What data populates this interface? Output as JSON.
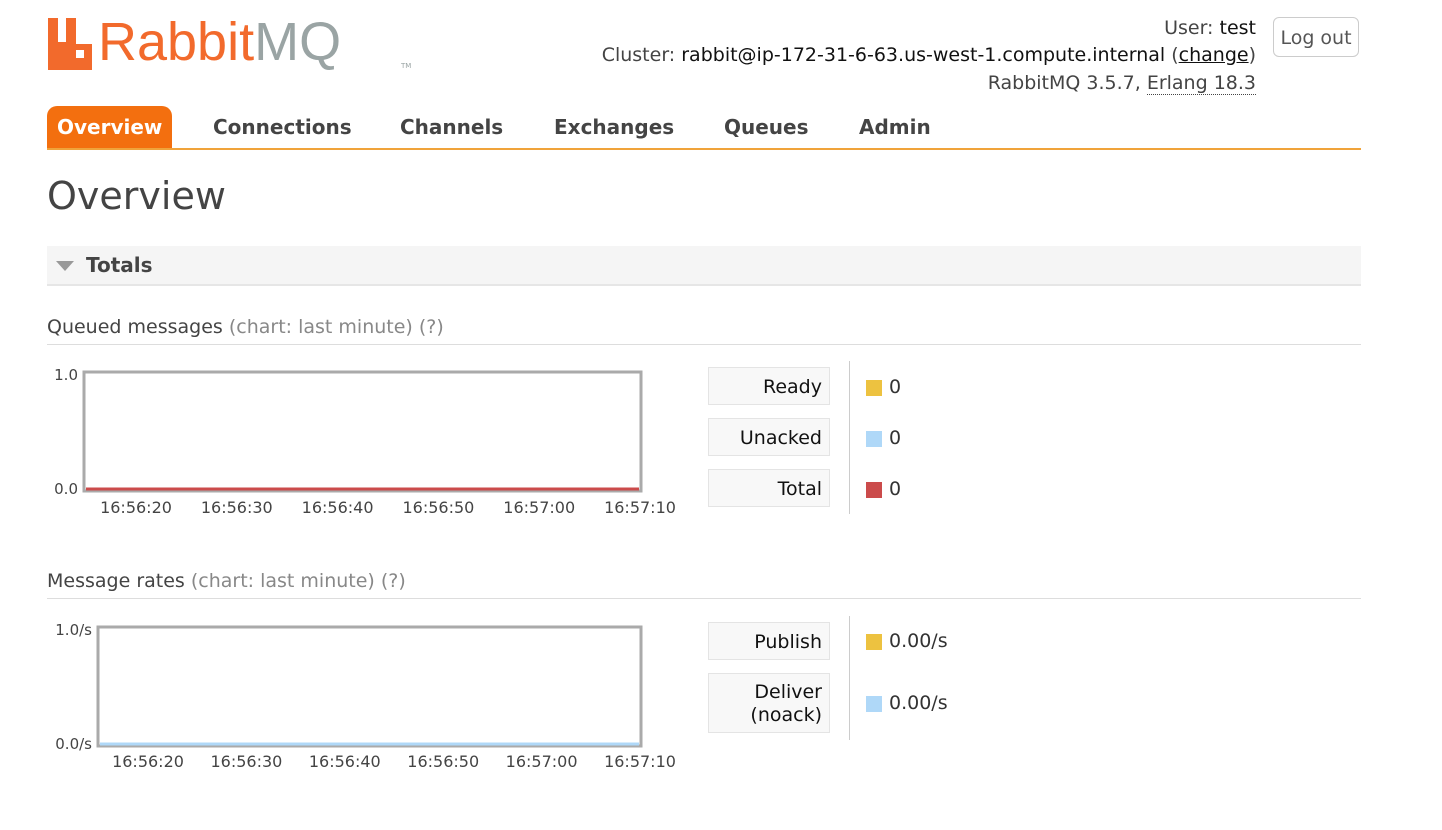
{
  "brand": {
    "rabbit": "Rabbit",
    "mq": "MQ",
    "tm": "TM"
  },
  "header": {
    "user_label": "User:",
    "user_value": "test",
    "cluster_label": "Cluster:",
    "cluster_value": "rabbit@ip-172-31-6-63.us-west-1.compute.internal",
    "change_link": "change",
    "version_text": "RabbitMQ 3.5.7,",
    "erlang_text": "Erlang 18.3",
    "logout_label": "Log out"
  },
  "tabs": [
    {
      "label": "Overview",
      "active": true
    },
    {
      "label": "Connections",
      "active": false
    },
    {
      "label": "Channels",
      "active": false
    },
    {
      "label": "Exchanges",
      "active": false
    },
    {
      "label": "Queues",
      "active": false
    },
    {
      "label": "Admin",
      "active": false
    }
  ],
  "page_title": "Overview",
  "totals_section": {
    "label": "Totals"
  },
  "queued_section": {
    "title": "Queued messages",
    "chart_note": "(chart: last minute)",
    "help": "(?)"
  },
  "rates_section": {
    "title": "Message rates",
    "chart_note": "(chart: last minute)",
    "help": "(?)"
  },
  "chart_data": [
    {
      "type": "line",
      "title": "Queued messages",
      "x": [
        "16:56:20",
        "16:56:30",
        "16:56:40",
        "16:56:50",
        "16:57:00",
        "16:57:10"
      ],
      "ytick_labels": [
        "1.0",
        "0.0"
      ],
      "ylim": [
        0,
        1
      ],
      "series": [
        {
          "name": "Ready",
          "values": [
            0,
            0,
            0,
            0,
            0,
            0
          ],
          "color": "#edc240",
          "display": "0"
        },
        {
          "name": "Unacked",
          "values": [
            0,
            0,
            0,
            0,
            0,
            0
          ],
          "color": "#afd8f8",
          "display": "0"
        },
        {
          "name": "Total",
          "values": [
            0,
            0,
            0,
            0,
            0,
            0
          ],
          "color": "#cb4b4b",
          "display": "0"
        }
      ]
    },
    {
      "type": "line",
      "title": "Message rates",
      "x": [
        "16:56:20",
        "16:56:30",
        "16:56:40",
        "16:56:50",
        "16:57:00",
        "16:57:10"
      ],
      "ytick_labels": [
        "1.0/s",
        "0.0/s"
      ],
      "ylim": [
        0,
        1
      ],
      "series": [
        {
          "name": "Publish",
          "values": [
            0,
            0,
            0,
            0,
            0,
            0
          ],
          "color": "#edc240",
          "display": "0.00/s"
        },
        {
          "name": "Deliver (noack)",
          "values": [
            0,
            0,
            0,
            0,
            0,
            0
          ],
          "color": "#afd8f8",
          "display": "0.00/s"
        }
      ]
    }
  ]
}
